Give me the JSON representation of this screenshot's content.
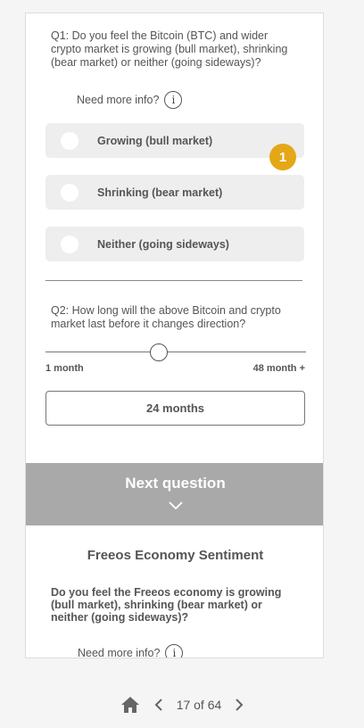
{
  "q1": {
    "text": "Q1: Do you feel the Bitcoin (BTC) and wider crypto market is growing (bull market), shrinking (bear market) or neither (going sideways)?",
    "info_label": "Need more info?",
    "info_icon": "info-icon",
    "options": [
      {
        "label": "Growing (bull market)"
      },
      {
        "label": "Shrinking (bear market)"
      },
      {
        "label": "Neither (going sideways)"
      }
    ],
    "badge": "1"
  },
  "q2": {
    "text": "Q2: How long will the above Bitcoin and crypto market last before it changes direction?",
    "slider_min": "1 month",
    "slider_max": "48 month +",
    "slider_fraction": 0.48,
    "value": "24 months"
  },
  "next_button": {
    "label": "Next question",
    "icon": "chevron-down-icon"
  },
  "section2": {
    "title": "Freeos Economy Sentiment",
    "question": "Do you feel the Freeos economy is growing (bull market), shrinking (bear market) or neither (going sideways)?",
    "info_label": "Need more info?"
  },
  "footer": {
    "page_indicator": "17 of 64",
    "home_icon": "home-icon",
    "prev_icon": "chevron-left-icon",
    "next_icon": "chevron-right-icon"
  },
  "colors": {
    "badge": "#e4a817",
    "option_bg": "#eeeeee",
    "next_button_bg": "#a9a9a9",
    "text": "#555555"
  }
}
